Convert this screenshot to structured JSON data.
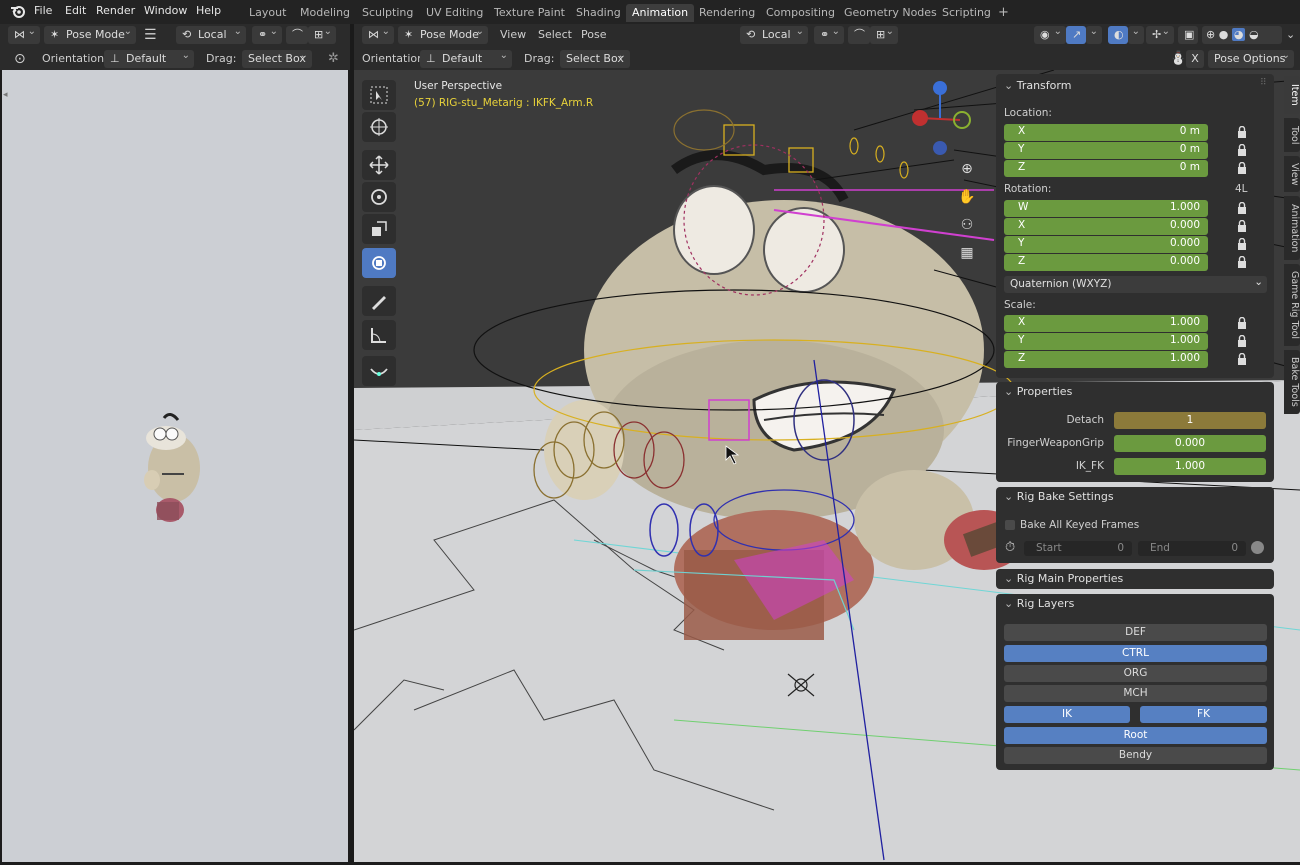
{
  "menubar": {
    "items": [
      "File",
      "Edit",
      "Render",
      "Window",
      "Help"
    ],
    "workspaces": [
      "Layout",
      "Modeling",
      "Sculpting",
      "UV Editing",
      "Texture Paint",
      "Shading",
      "Animation",
      "Rendering",
      "Compositing",
      "Geometry Nodes",
      "Scripting"
    ],
    "active_workspace": "Animation",
    "add_tab": "+"
  },
  "left_header": {
    "mode": "Pose Mode",
    "transform_space": "Local",
    "orientation_label": "Orientation:",
    "orientation_value": "Default",
    "drag_label": "Drag:",
    "drag_value": "Select Box"
  },
  "viewport_header": {
    "mode": "Pose Mode",
    "menus": [
      "View",
      "Select",
      "Pose"
    ],
    "transform_space": "Local",
    "orientation_label": "Orientation:",
    "orientation_value": "Default",
    "drag_label": "Drag:",
    "drag_value": "Select Box",
    "pose_options": "Pose Options",
    "close_x": "X"
  },
  "viewport": {
    "perspective": "User Perspective",
    "active_object": "(57) RIG-stu_Metarig : IKFK_Arm.R"
  },
  "transform": {
    "title": "Transform",
    "location_label": "Location:",
    "location": [
      {
        "k": "X",
        "v": "0 m"
      },
      {
        "k": "Y",
        "v": "0 m"
      },
      {
        "k": "Z",
        "v": "0 m"
      }
    ],
    "rotation_label": "Rotation:",
    "rotation_flag": "4L",
    "rotation": [
      {
        "k": "W",
        "v": "1.000"
      },
      {
        "k": "X",
        "v": "0.000"
      },
      {
        "k": "Y",
        "v": "0.000"
      },
      {
        "k": "Z",
        "v": "0.000"
      }
    ],
    "rotation_mode": "Quaternion (WXYZ)",
    "scale_label": "Scale:",
    "scale": [
      {
        "k": "X",
        "v": "1.000"
      },
      {
        "k": "Y",
        "v": "1.000"
      },
      {
        "k": "Z",
        "v": "1.000"
      }
    ]
  },
  "properties": {
    "title": "Properties",
    "items": [
      {
        "label": "Detach",
        "value": "1",
        "color": "#8c7a3a"
      },
      {
        "label": "FingerWeaponGrip",
        "value": "0.000",
        "color": "#6b9a3f"
      },
      {
        "label": "IK_FK",
        "value": "1.000",
        "color": "#6b9a3f"
      }
    ]
  },
  "rig_bake": {
    "title": "Rig Bake Settings",
    "checkbox_label": "Bake All Keyed Frames",
    "start_label": "Start",
    "start_value": "0",
    "end_label": "End",
    "end_value": "0"
  },
  "rig_main": {
    "title": "Rig Main Properties"
  },
  "rig_layers": {
    "title": "Rig Layers",
    "layers": [
      {
        "label": "DEF",
        "on": false
      },
      {
        "label": "CTRL",
        "on": true
      },
      {
        "label": "ORG",
        "on": false
      },
      {
        "label": "MCH",
        "on": false
      },
      {
        "label": "IK",
        "on": true
      },
      {
        "label": "FK",
        "on": true
      },
      {
        "label": "Root",
        "on": true
      },
      {
        "label": "Bendy",
        "on": false
      }
    ]
  },
  "side_tabs": [
    "Item",
    "Tool",
    "View",
    "Animation",
    "Game Rig Tool",
    "Bake Tools"
  ],
  "colors": {
    "accent": "#4f7ac3",
    "field_green": "#6b9a3f",
    "field_yellow": "#8c7a3a",
    "rig_magenta": "#d040d0",
    "rig_yellow": "#d8b020"
  }
}
